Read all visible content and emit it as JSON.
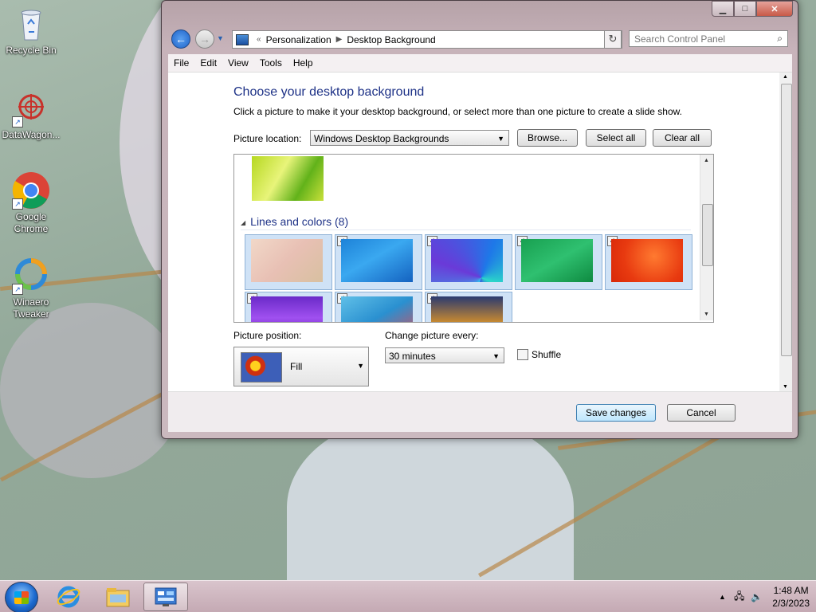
{
  "desktop": {
    "icons": [
      {
        "label": "Recycle Bin"
      },
      {
        "label": "DataWagon..."
      },
      {
        "label": "Google Chrome"
      },
      {
        "label": "Winaero Tweaker"
      }
    ]
  },
  "window": {
    "breadcrumb": [
      "Personalization",
      "Desktop Background"
    ],
    "search_placeholder": "Search Control Panel",
    "menu": [
      "File",
      "Edit",
      "View",
      "Tools",
      "Help"
    ],
    "title": "Choose your desktop background",
    "subtitle": "Click a picture to make it your desktop background, or select more than one picture to create a slide show.",
    "picture_location_label": "Picture location:",
    "picture_location_value": "Windows Desktop Backgrounds",
    "buttons": {
      "browse": "Browse...",
      "select_all": "Select all",
      "clear_all": "Clear all"
    },
    "group_title": "Lines and colors (8)",
    "picture_position_label": "Picture position:",
    "picture_position_value": "Fill",
    "change_every_label": "Change picture every:",
    "change_every_value": "30 minutes",
    "shuffle_label": "Shuffle",
    "save_label": "Save changes",
    "cancel_label": "Cancel"
  },
  "taskbar": {
    "time": "1:48 AM",
    "date": "2/3/2023"
  }
}
